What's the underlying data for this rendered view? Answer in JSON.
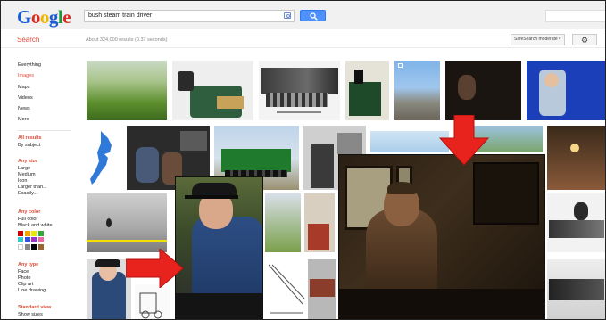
{
  "header": {
    "logo_letters": [
      "G",
      "o",
      "o",
      "g",
      "l",
      "e"
    ],
    "search_value": "bush steam train driver"
  },
  "subheader": {
    "section_title": "Search",
    "results_count": "About 324,000 results (0.37 seconds)",
    "safesearch_label": "SafeSearch moderate ▾"
  },
  "sidebar": {
    "nav": [
      "Everything",
      "Images",
      "Maps",
      "Videos",
      "News",
      "More"
    ],
    "active_nav": "Images",
    "all_results": {
      "title": "All results",
      "items": [
        "By subject"
      ]
    },
    "size": {
      "title": "Any size",
      "items": [
        "Large",
        "Medium",
        "Icon",
        "Larger than...",
        "Exactly..."
      ]
    },
    "color": {
      "title": "Any color",
      "items": [
        "Full color",
        "Black and white"
      ],
      "swatches": [
        "#cc0000",
        "#f4a400",
        "#e8e800",
        "#33aa33",
        "#33cccc",
        "#3355dd",
        "#9933cc",
        "#ee66aa",
        "#ffffff",
        "#888888",
        "#000000",
        "#996633"
      ]
    },
    "type": {
      "title": "Any type",
      "items": [
        "Face",
        "Photo",
        "Clip art",
        "Line drawing"
      ]
    },
    "view": {
      "title": "Standard view",
      "items": [
        "Show sizes"
      ]
    }
  },
  "colors": {
    "logo": [
      "#1a5cd6",
      "#d92b1f",
      "#f1b400",
      "#1a5cd6",
      "#1a9b3a",
      "#d92b1f"
    ],
    "accent_red": "#dd4b39",
    "search_blue": "#4d90fe",
    "arrow_red": "#e8231e"
  }
}
